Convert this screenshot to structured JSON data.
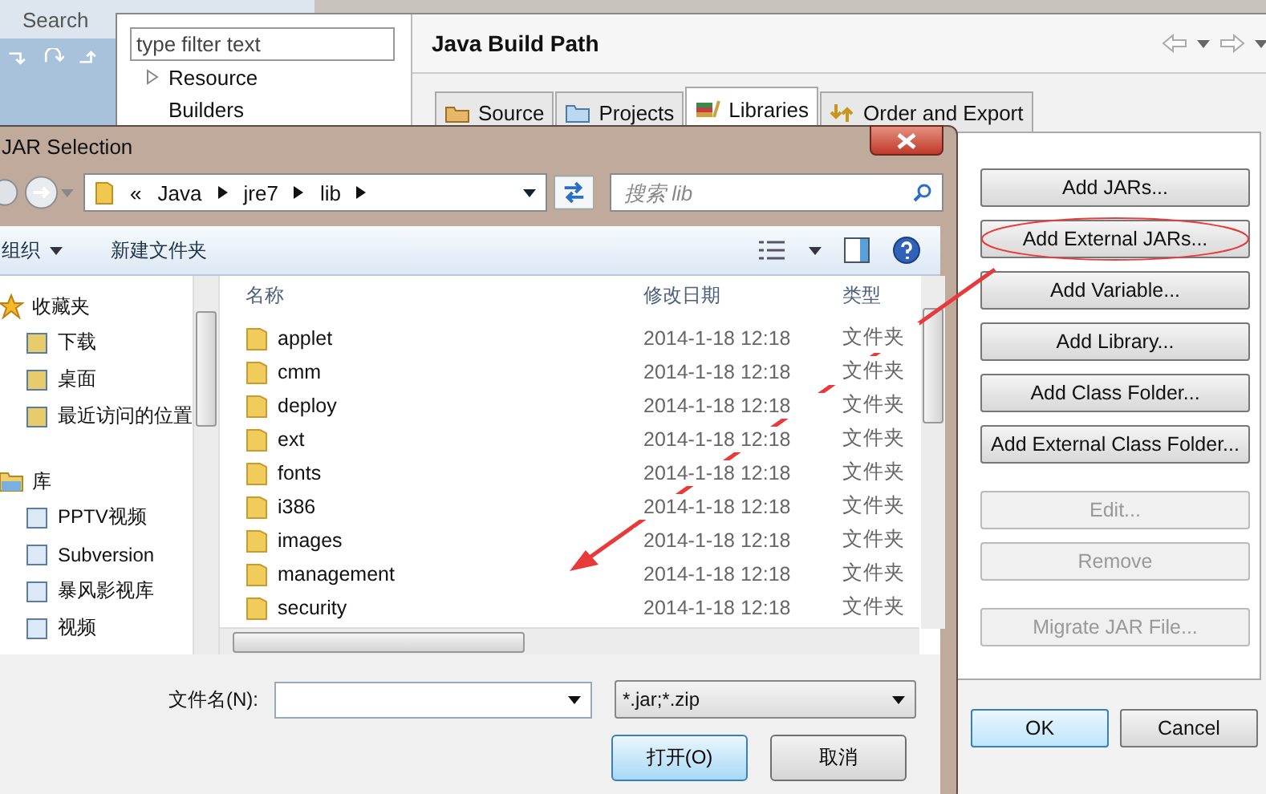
{
  "ide": {
    "search_label": "Search"
  },
  "properties": {
    "filter": {
      "placeholder": "type filter text"
    },
    "tree": [
      {
        "label": "Resource",
        "expanded": false
      },
      {
        "label": "Builders"
      }
    ],
    "page_title": "Java Build Path",
    "tabs": [
      {
        "label": "Source",
        "selected": false
      },
      {
        "label": "Projects",
        "selected": false
      },
      {
        "label": "Libraries",
        "selected": true
      },
      {
        "label": "Order and Export",
        "selected": false
      }
    ],
    "button_groups": [
      [
        {
          "label": "Add JARs...",
          "disabled": false,
          "circled": false
        },
        {
          "label": "Add External JARs...",
          "disabled": false,
          "circled": true
        },
        {
          "label": "Add Variable...",
          "disabled": false,
          "circled": false
        },
        {
          "label": "Add Library...",
          "disabled": false,
          "circled": false
        },
        {
          "label": "Add Class Folder...",
          "disabled": false,
          "circled": false
        },
        {
          "label": "Add External Class Folder...",
          "disabled": false,
          "circled": false
        }
      ],
      [
        {
          "label": "Edit...",
          "disabled": true,
          "circled": false
        },
        {
          "label": "Remove",
          "disabled": true,
          "circled": false
        }
      ],
      [
        {
          "label": "Migrate JAR File...",
          "disabled": true,
          "circled": false
        }
      ]
    ],
    "dialog_buttons": [
      "OK",
      "Cancel"
    ]
  },
  "jar_dialog": {
    "title": "JAR Selection",
    "overflow_mark": "«",
    "breadcrumb": [
      "Java",
      "jre7",
      "lib"
    ],
    "search": {
      "placeholder": "搜索 lib"
    },
    "toolbar": {
      "organize": "组织",
      "new_folder": "新建文件夹"
    },
    "nav": [
      {
        "label": "收藏夹",
        "children": [
          "下载",
          "桌面",
          "最近访问的位置"
        ]
      },
      {
        "label": "库",
        "children": [
          "PPTV视频",
          "Subversion",
          "暴风影视库",
          "视频"
        ]
      }
    ],
    "columns": [
      "名称",
      "修改日期",
      "类型"
    ],
    "rows": [
      {
        "name": "applet",
        "date": "2014-1-18 12:18",
        "type": "文件夹"
      },
      {
        "name": "cmm",
        "date": "2014-1-18 12:18",
        "type": "文件夹"
      },
      {
        "name": "deploy",
        "date": "2014-1-18 12:18",
        "type": "文件夹"
      },
      {
        "name": "ext",
        "date": "2014-1-18 12:18",
        "type": "文件夹"
      },
      {
        "name": "fonts",
        "date": "2014-1-18 12:18",
        "type": "文件夹"
      },
      {
        "name": "i386",
        "date": "2014-1-18 12:18",
        "type": "文件夹"
      },
      {
        "name": "images",
        "date": "2014-1-18 12:18",
        "type": "文件夹"
      },
      {
        "name": "management",
        "date": "2014-1-18 12:18",
        "type": "文件夹"
      },
      {
        "name": "security",
        "date": "2014-1-18 12:18",
        "type": "文件夹"
      }
    ],
    "filename_label": "文件名(N):",
    "filter": "*.jar;*.zip",
    "buttons": [
      "打开(O)",
      "取消"
    ]
  }
}
